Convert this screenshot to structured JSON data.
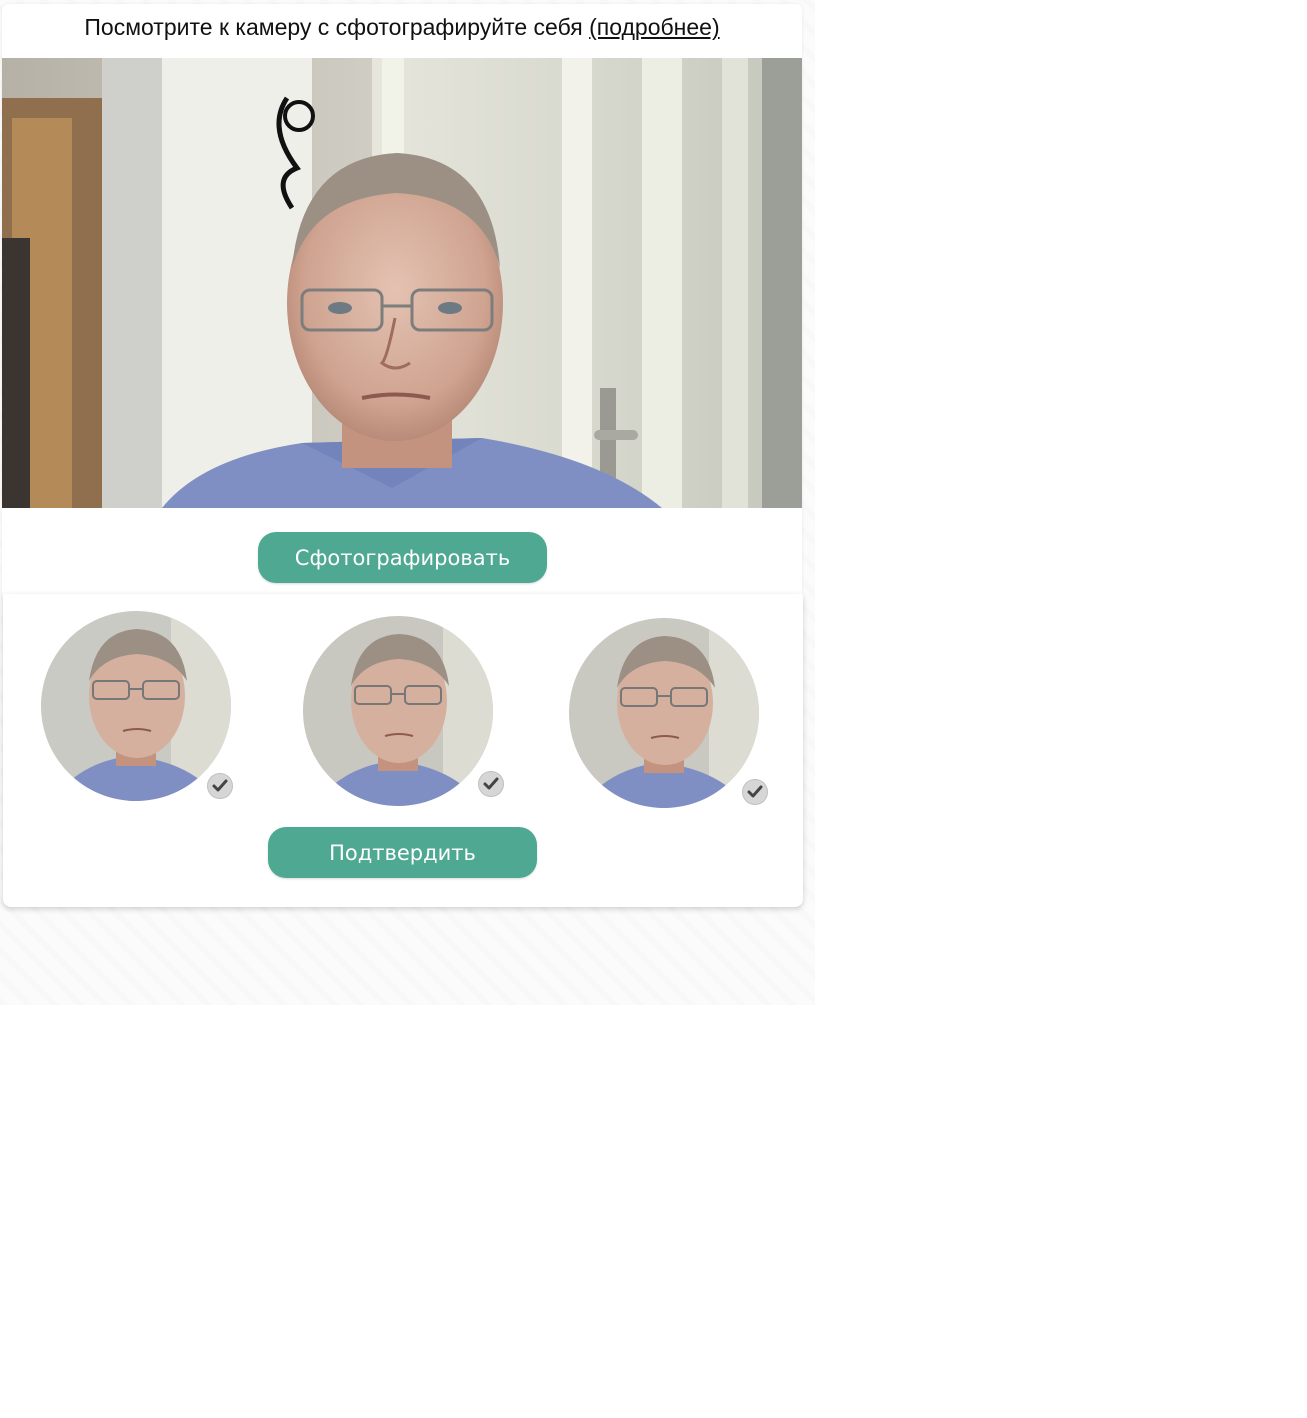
{
  "header": {
    "instruction": "Посмотрите к камеру с сфотографируйте себя",
    "more_link": "(подробнее)"
  },
  "buttons": {
    "capture": "Сфотографировать",
    "confirm": "Подтвердить"
  },
  "thumbnails": [
    {
      "selected": true,
      "icon": "check-icon"
    },
    {
      "selected": true,
      "icon": "check-icon"
    },
    {
      "selected": true,
      "icon": "check-icon"
    }
  ],
  "colors": {
    "accent": "#4ea892",
    "check_bg": "#d6d6d6",
    "check_mark": "#444444"
  }
}
